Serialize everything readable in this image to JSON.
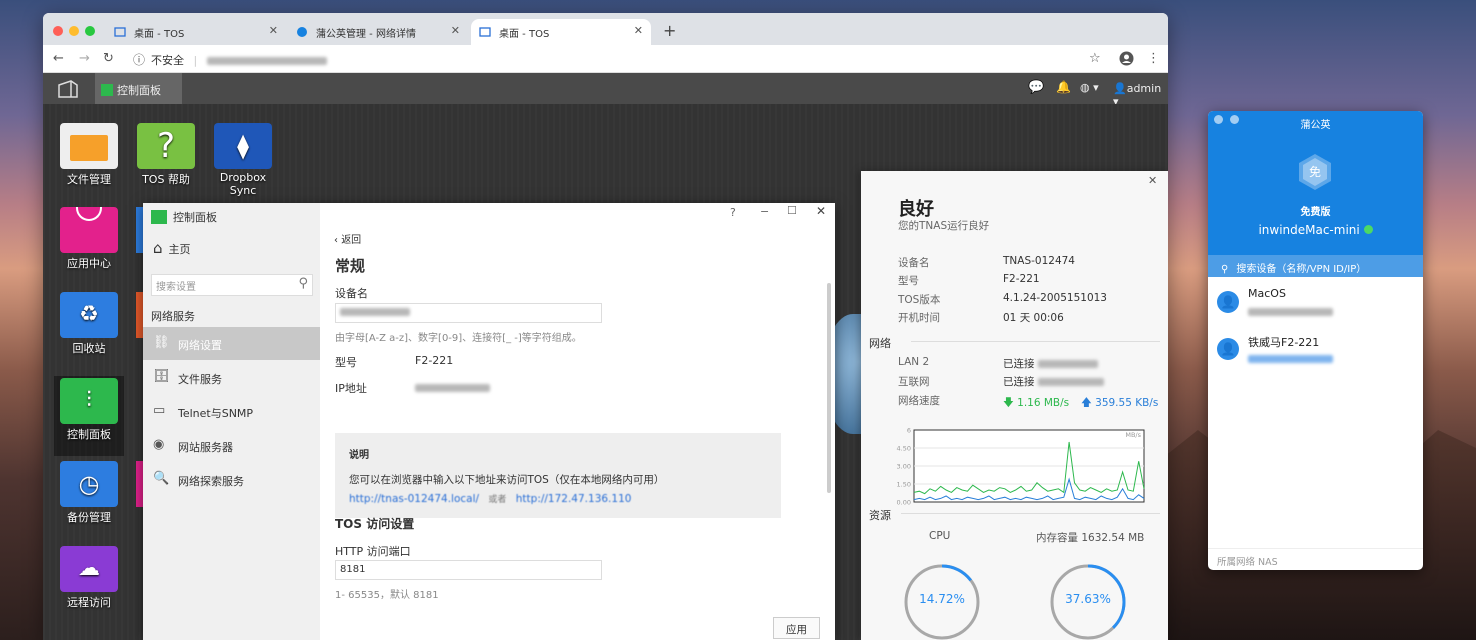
{
  "browser": {
    "tabs": [
      {
        "label": "桌面 - TOS"
      },
      {
        "label": "蒲公英管理 - 网络详情"
      },
      {
        "label": "桌面 - TOS"
      }
    ],
    "security": "不安全",
    "url": "172.47.136.110:8181/"
  },
  "tos_top": {
    "control_panel": "控制面板",
    "user": "admin"
  },
  "desktop_icons": [
    {
      "label": "文件管理"
    },
    {
      "label": "TOS 帮助"
    },
    {
      "label": "Dropbox Sync"
    },
    {
      "label": "应用中心"
    },
    {
      "label": "回收站"
    },
    {
      "label": "控制面板"
    },
    {
      "label": "备份管理"
    },
    {
      "label": "远程访问"
    }
  ],
  "control_panel": {
    "title": "控制面板",
    "home": "主页",
    "search_placeholder": "搜索设置",
    "section": "网络服务",
    "items": [
      {
        "label": "网络设置"
      },
      {
        "label": "文件服务"
      },
      {
        "label": "Telnet与SNMP"
      },
      {
        "label": "网站服务器"
      },
      {
        "label": "网络探索服务"
      }
    ],
    "help": "?",
    "back": "返回",
    "heading": "常规",
    "device_name_label": "设备名",
    "device_name_value": "TNAS-012474",
    "device_name_hint": "由字母[A-Z a-z]、数字[0-9]、连接符[_ -]等字符组成。",
    "model_label": "型号",
    "model_value": "F2-221",
    "ip_label": "IP地址",
    "ip_value": "172.47.136.110",
    "note_title": "说明",
    "note_text": "您可以在浏览器中输入以下地址来访问TOS（仅在本地网络内可用）",
    "note_link1": "http://tnas-012474.local/",
    "note_or": "或者",
    "note_link2": "http://172.47.136.110",
    "tos_access_heading": "TOS 访问设置",
    "http_port_label": "HTTP 访问端口",
    "http_port_value": "8181",
    "http_port_hint": "1- 65535，默认 8181",
    "apply": "应用"
  },
  "status": {
    "title": "良好",
    "subtitle": "您的TNAS运行良好",
    "info": [
      {
        "k": "设备名",
        "v": "TNAS-012474"
      },
      {
        "k": "型号",
        "v": "F2-221"
      },
      {
        "k": "TOS版本",
        "v": "4.1.24-2005151013"
      },
      {
        "k": "开机时间",
        "v": "01 天 00:06"
      }
    ],
    "net_section": "网络",
    "lan_label": "LAN 2",
    "lan_value": "已连接",
    "inet_label": "互联网",
    "inet_value": "已连接",
    "speed_label": "网络速度",
    "down": "1.16 MB/s",
    "up": "359.55 KB/s",
    "res_section": "资源",
    "cpu_label": "CPU",
    "cpu_value": "14.72%",
    "mem_label": "内存容量 1632.54 MB",
    "mem_value": "37.63%",
    "colors": {
      "down": "#2db84d",
      "up": "#2a7fd8",
      "ring": "#2a8ef0"
    }
  },
  "chart_data": {
    "type": "line",
    "title": "",
    "xlabel": "",
    "ylabel": "",
    "unit": "MB/s",
    "yticks": [
      "6",
      "4.50",
      "3.00",
      "1.50",
      "0.00"
    ],
    "ylim": [
      0,
      6
    ],
    "series": [
      {
        "values": [
          0.8,
          0.9,
          0.7,
          1.1,
          0.9,
          1.3,
          1.0,
          0.8,
          1.2,
          1.0,
          0.9,
          1.4,
          1.1,
          0.8,
          1.0,
          0.9,
          1.2,
          1.1,
          0.8,
          1.0,
          1.3,
          0.9,
          1.0,
          1.6,
          1.2,
          0.9,
          1.0,
          1.1,
          0.8,
          5.0,
          1.6,
          1.0,
          0.9,
          1.2,
          1.0,
          0.8,
          1.1,
          0.9,
          1.0,
          2.5,
          1.0,
          0.9,
          3.4,
          1.1
        ]
      },
      {
        "values": [
          0.2,
          0.3,
          0.2,
          0.4,
          0.2,
          0.3,
          0.5,
          0.2,
          0.3,
          0.2,
          0.4,
          0.3,
          0.2,
          0.3,
          0.5,
          0.2,
          0.3,
          0.4,
          0.2,
          0.3,
          0.2,
          0.4,
          0.3,
          0.2,
          0.3,
          0.5,
          0.2,
          0.3,
          0.4,
          1.9,
          0.3,
          0.2,
          0.4,
          0.3,
          0.2,
          0.5,
          0.3,
          0.2,
          0.4,
          1.1,
          0.3,
          0.2,
          0.6,
          0.3
        ]
      }
    ]
  },
  "pgy": {
    "title": "蒲公英",
    "logo_char": "免",
    "edition": "免费版",
    "hostname": "inwindeMac-mini",
    "search": "搜索设备（名称/VPN ID/IP）",
    "devices": [
      {
        "name": "MacOS"
      },
      {
        "name": "铁威马F2-221"
      }
    ],
    "footer": "所属网络 NAS"
  }
}
